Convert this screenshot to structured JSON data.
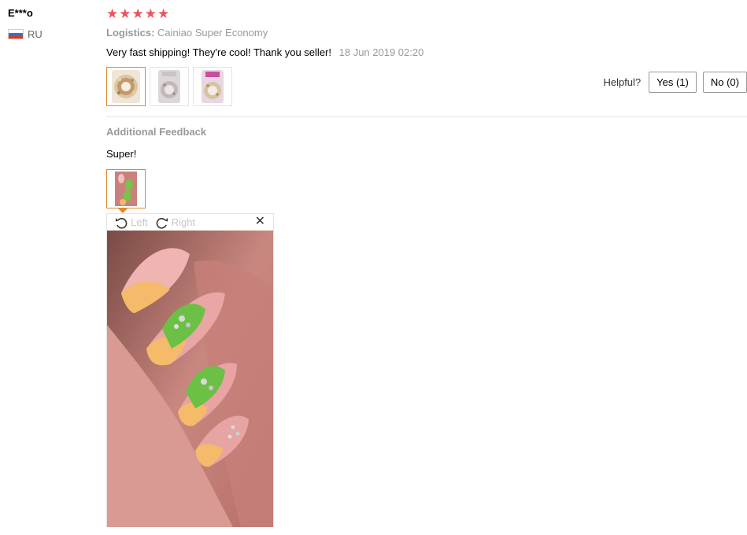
{
  "reviewer": {
    "name": "E***o",
    "country": "RU"
  },
  "rating": {
    "stars": 5,
    "max": 5
  },
  "logistics": {
    "label": "Logistics:",
    "value": "Cainiao Super Economy"
  },
  "review": {
    "text": "Very fast shipping! They're cool! Thank you seller!",
    "date": "18 Jun 2019 02:20"
  },
  "photos": [
    {
      "icon": "nail-wheel-photo"
    },
    {
      "icon": "nail-wheel-photo"
    },
    {
      "icon": "nail-wheel-photo"
    }
  ],
  "helpful": {
    "label": "Helpful?",
    "yes": "Yes (1)",
    "no": "No (0)"
  },
  "additional": {
    "title": "Additional Feedback",
    "text": "Super!"
  },
  "viewer": {
    "rotate_left": "Left",
    "rotate_right": "Right",
    "close": "✕"
  },
  "colors": {
    "star": "#f0515a",
    "accent": "#e08a2e",
    "muted": "#999999"
  }
}
